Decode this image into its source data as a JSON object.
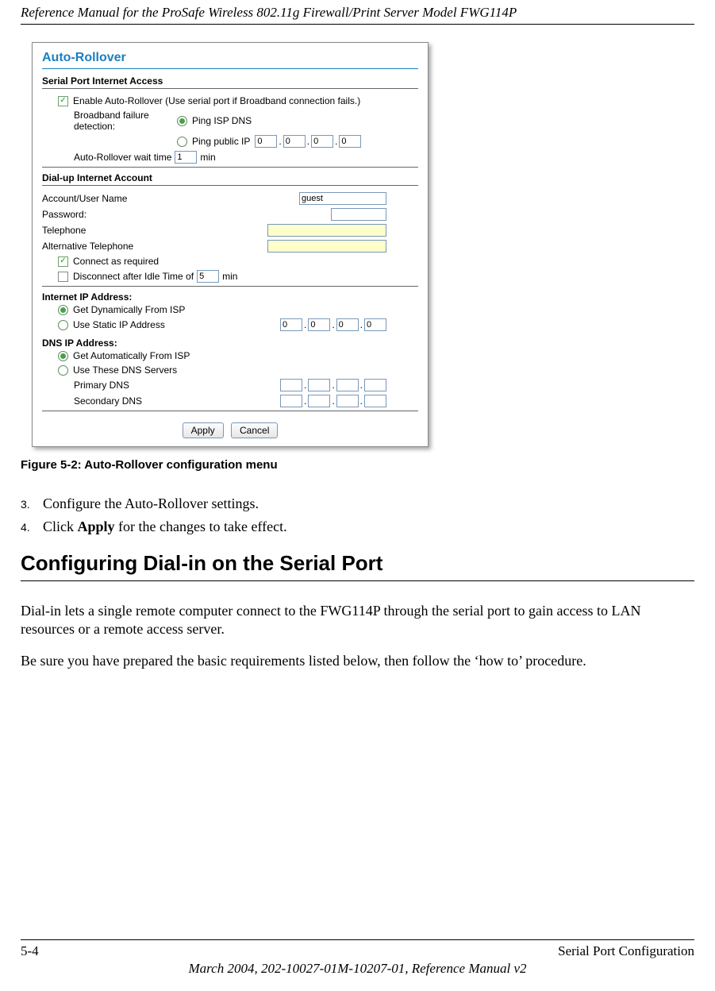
{
  "header": {
    "title": "Reference Manual for the ProSafe Wireless 802.11g  Firewall/Print Server Model FWG114P"
  },
  "screenshot": {
    "title": "Auto-Rollover",
    "sec1": {
      "header": "Serial Port Internet Access",
      "enable_label": "Enable Auto-Rollover (Use serial port if Broadband connection fails.)",
      "bfd_label": "Broadband failure detection:",
      "ping_isp": "Ping ISP DNS",
      "ping_public": "Ping public IP",
      "ip": [
        "0",
        "0",
        "0",
        "0"
      ],
      "wait_label_pre": "Auto-Rollover wait time",
      "wait_val": "1",
      "wait_label_post": "min"
    },
    "sec2": {
      "header": "Dial-up Internet Account",
      "acct_label": "Account/User Name",
      "acct_val": "guest",
      "pwd_label": "Password:",
      "pwd_val": "",
      "tel_label": "Telephone",
      "tel_val": "",
      "alt_label": "Alternative Telephone",
      "alt_val": "",
      "connect_label": "Connect as required",
      "disc_label_pre": "Disconnect after Idle Time of",
      "disc_val": "5",
      "disc_label_post": "min"
    },
    "sec3": {
      "ip_header": "Internet IP Address:",
      "dyn_label": "Get Dynamically From ISP",
      "static_label": "Use Static IP Address",
      "static_ip": [
        "0",
        "0",
        "0",
        "0"
      ],
      "dns_header": "DNS IP Address:",
      "auto_label": "Get Automatically From ISP",
      "use_label": "Use These DNS Servers",
      "pdns_label": "Primary DNS",
      "pdns": [
        "",
        "",
        "",
        ""
      ],
      "sdns_label": "Secondary DNS",
      "sdns": [
        "",
        "",
        "",
        ""
      ]
    },
    "buttons": {
      "apply": "Apply",
      "cancel": "Cancel"
    }
  },
  "figure_caption": "Figure 5-2:  Auto-Rollover configuration menu",
  "steps": {
    "s3_num": "3.",
    "s3": "Configure the Auto-Rollover settings.",
    "s4_num": "4.",
    "s4_pre": "Click ",
    "s4_bold": "Apply",
    "s4_post": " for the changes to take effect."
  },
  "h2": "Configuring Dial-in on the Serial Port",
  "para1": "Dial-in lets a single remote computer connect to the FWG114P through the serial port to gain access to LAN resources or a remote access server.",
  "para2": "Be sure you have prepared the basic requirements listed below, then follow the ‘how to’ procedure.",
  "footer": {
    "page": "5-4",
    "right": "Serial Port Configuration",
    "line2": "March 2004, 202-10027-01M-10207-01, Reference Manual v2"
  }
}
